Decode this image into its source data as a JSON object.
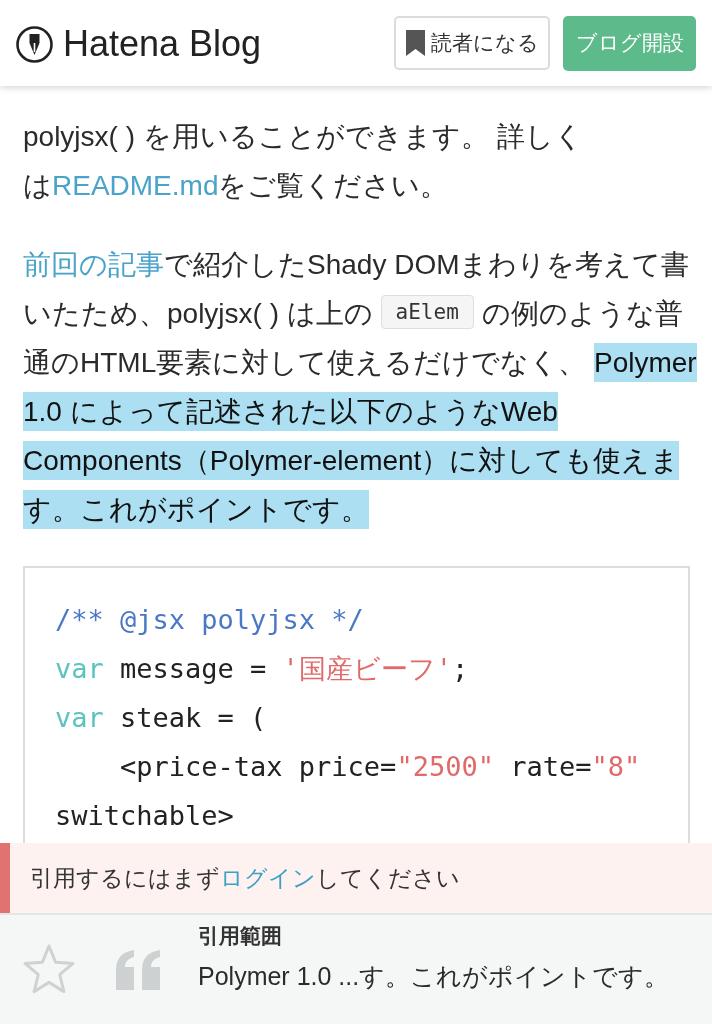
{
  "header": {
    "logo": "Hatena Blog",
    "buttons": [
      {
        "kind": "subscribe",
        "label": "読者になる"
      },
      {
        "kind": "primary",
        "label": "ブログ開設"
      }
    ]
  },
  "article": {
    "paragraphs": [
      {
        "lines": [
          [
            {
              "kind": "text",
              "text": "polyjsx( ) を用いることができます。 詳しく"
            }
          ],
          [
            {
              "kind": "text",
              "text": "は"
            },
            {
              "kind": "link",
              "text": "README.md"
            },
            {
              "kind": "text",
              "text": "をご覧ください。"
            }
          ]
        ]
      },
      {
        "lines": [
          [
            {
              "kind": "link",
              "text": "前回の記事"
            },
            {
              "kind": "text",
              "text": "で紹介したShady DOMまわりを考えて書"
            }
          ],
          [
            {
              "kind": "text",
              "text": "いたため、polyjsx( ) は上の "
            },
            {
              "kind": "code",
              "text": "aElem"
            },
            {
              "kind": "text",
              "text": " の例のような普"
            }
          ],
          [
            {
              "kind": "text",
              "text": "通のHTML要素に対して使えるだけでなく、 "
            },
            {
              "kind": "text",
              "text": "Polymer",
              "selected": true
            }
          ],
          [
            {
              "kind": "text",
              "text": "1.0 によって記述された以下のようなWeb",
              "selected": true
            }
          ],
          [
            {
              "kind": "text",
              "text": "Components（Polymer-element）に対しても使えま",
              "selected": true
            }
          ],
          [
            {
              "kind": "text",
              "text": "す。これがポイントです。",
              "selected": true
            }
          ]
        ]
      }
    ],
    "code_block": {
      "lines": [
        [
          {
            "kind": "comment",
            "text": "/** @jsx polyjsx */"
          }
        ],
        [
          {
            "kind": "keyword",
            "text": "var"
          },
          {
            "kind": "plain",
            "text": " message = "
          },
          {
            "kind": "string",
            "text": "'国産ビーフ'"
          },
          {
            "kind": "plain",
            "text": ";"
          }
        ],
        [
          {
            "kind": "keyword",
            "text": "var"
          },
          {
            "kind": "plain",
            "text": " steak = ("
          }
        ],
        [
          {
            "kind": "plain",
            "text": "    <price-tax price="
          },
          {
            "kind": "string",
            "text": "\"2500\""
          },
          {
            "kind": "plain",
            "text": " rate="
          },
          {
            "kind": "string",
            "text": "\"8\""
          },
          {
            "kind": "plain",
            "text": " switchable>"
          }
        ]
      ]
    }
  },
  "notice": {
    "before": "引用するにはまず",
    "link": "ログイン",
    "after": "してください"
  },
  "quote_bar": {
    "title": "引用範囲",
    "excerpt": "Polymer 1.0 ...す。これがポイントです。"
  }
}
